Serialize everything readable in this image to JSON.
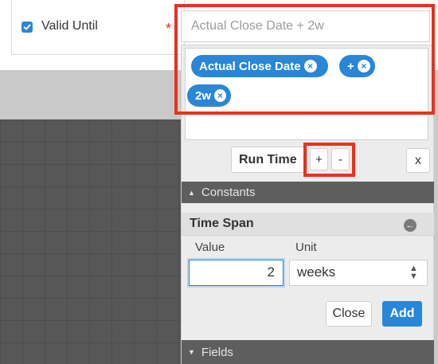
{
  "valid_until": {
    "label": "Valid Until",
    "checked": true,
    "required_marker": "*"
  },
  "formula": {
    "text": "Actual Close Date + 2w",
    "tokens": [
      {
        "label": "Actual Close Date"
      },
      {
        "label": "+"
      },
      {
        "label": "2w"
      }
    ],
    "token_remove_icon": "close-circle-icon"
  },
  "toolbar": {
    "run_time_label": "Run Time",
    "plus_label": "+",
    "minus_label": "-",
    "close_label": "x"
  },
  "constants": {
    "header": "Constants",
    "time_span": {
      "title": "Time Span",
      "value_label": "Value",
      "unit_label": "Unit",
      "value": "2",
      "unit": "weeks",
      "close_label": "Close",
      "add_label": "Add"
    }
  },
  "fields": {
    "header": "Fields"
  },
  "colors": {
    "accent": "#2a86d6",
    "highlight": "#e8321c",
    "section_bg": "#5e5e5e"
  }
}
